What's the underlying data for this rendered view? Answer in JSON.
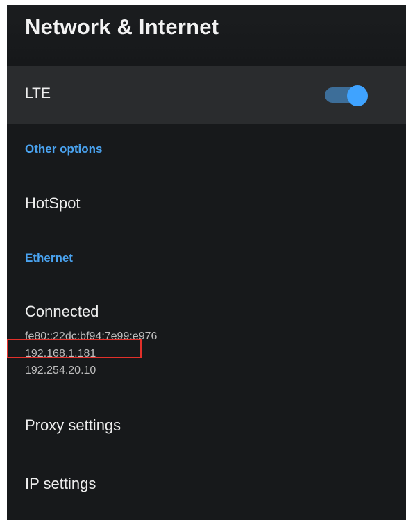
{
  "header": {
    "title": "Network & Internet"
  },
  "lte": {
    "label": "LTE",
    "enabled": true
  },
  "sections": {
    "other_options": {
      "header": "Other options",
      "hotspot_label": "HotSpot"
    },
    "ethernet": {
      "header": "Ethernet",
      "status": "Connected",
      "addresses": [
        "fe80::22dc:bf94:7e99:e976",
        "192.168.1.181",
        "192.254.20.10"
      ],
      "highlighted_address_index": 1
    }
  },
  "menu": {
    "proxy_label": "Proxy settings",
    "ip_label": "IP settings"
  },
  "colors": {
    "background": "#17191b",
    "selected_row": "#2a2c2e",
    "accent": "#4aa3f0",
    "toggle_on": "#3fa3ff",
    "highlight": "#e2302a"
  }
}
